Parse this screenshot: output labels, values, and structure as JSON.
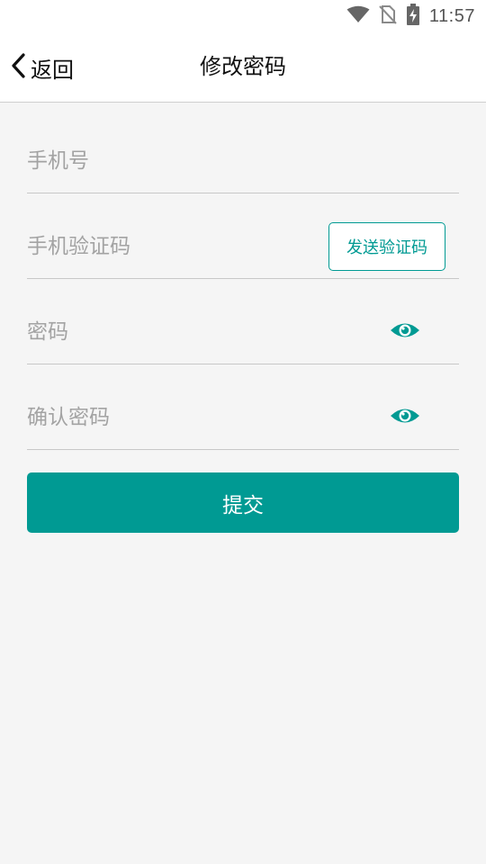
{
  "status_bar": {
    "time": "11:57",
    "icons": [
      "wifi-icon",
      "no-sim-icon",
      "battery-charging-icon"
    ]
  },
  "header": {
    "back_label": "返回",
    "title": "修改密码"
  },
  "form": {
    "phone_placeholder": "手机号",
    "sms_code_placeholder": "手机验证码",
    "send_code_label": "发送验证码",
    "password_placeholder": "密码",
    "confirm_password_placeholder": "确认密码",
    "submit_label": "提交"
  },
  "colors": {
    "accent": "#009a93",
    "background": "#f5f5f5",
    "placeholder": "#a3a3a3",
    "divider": "#c8c8c8"
  }
}
